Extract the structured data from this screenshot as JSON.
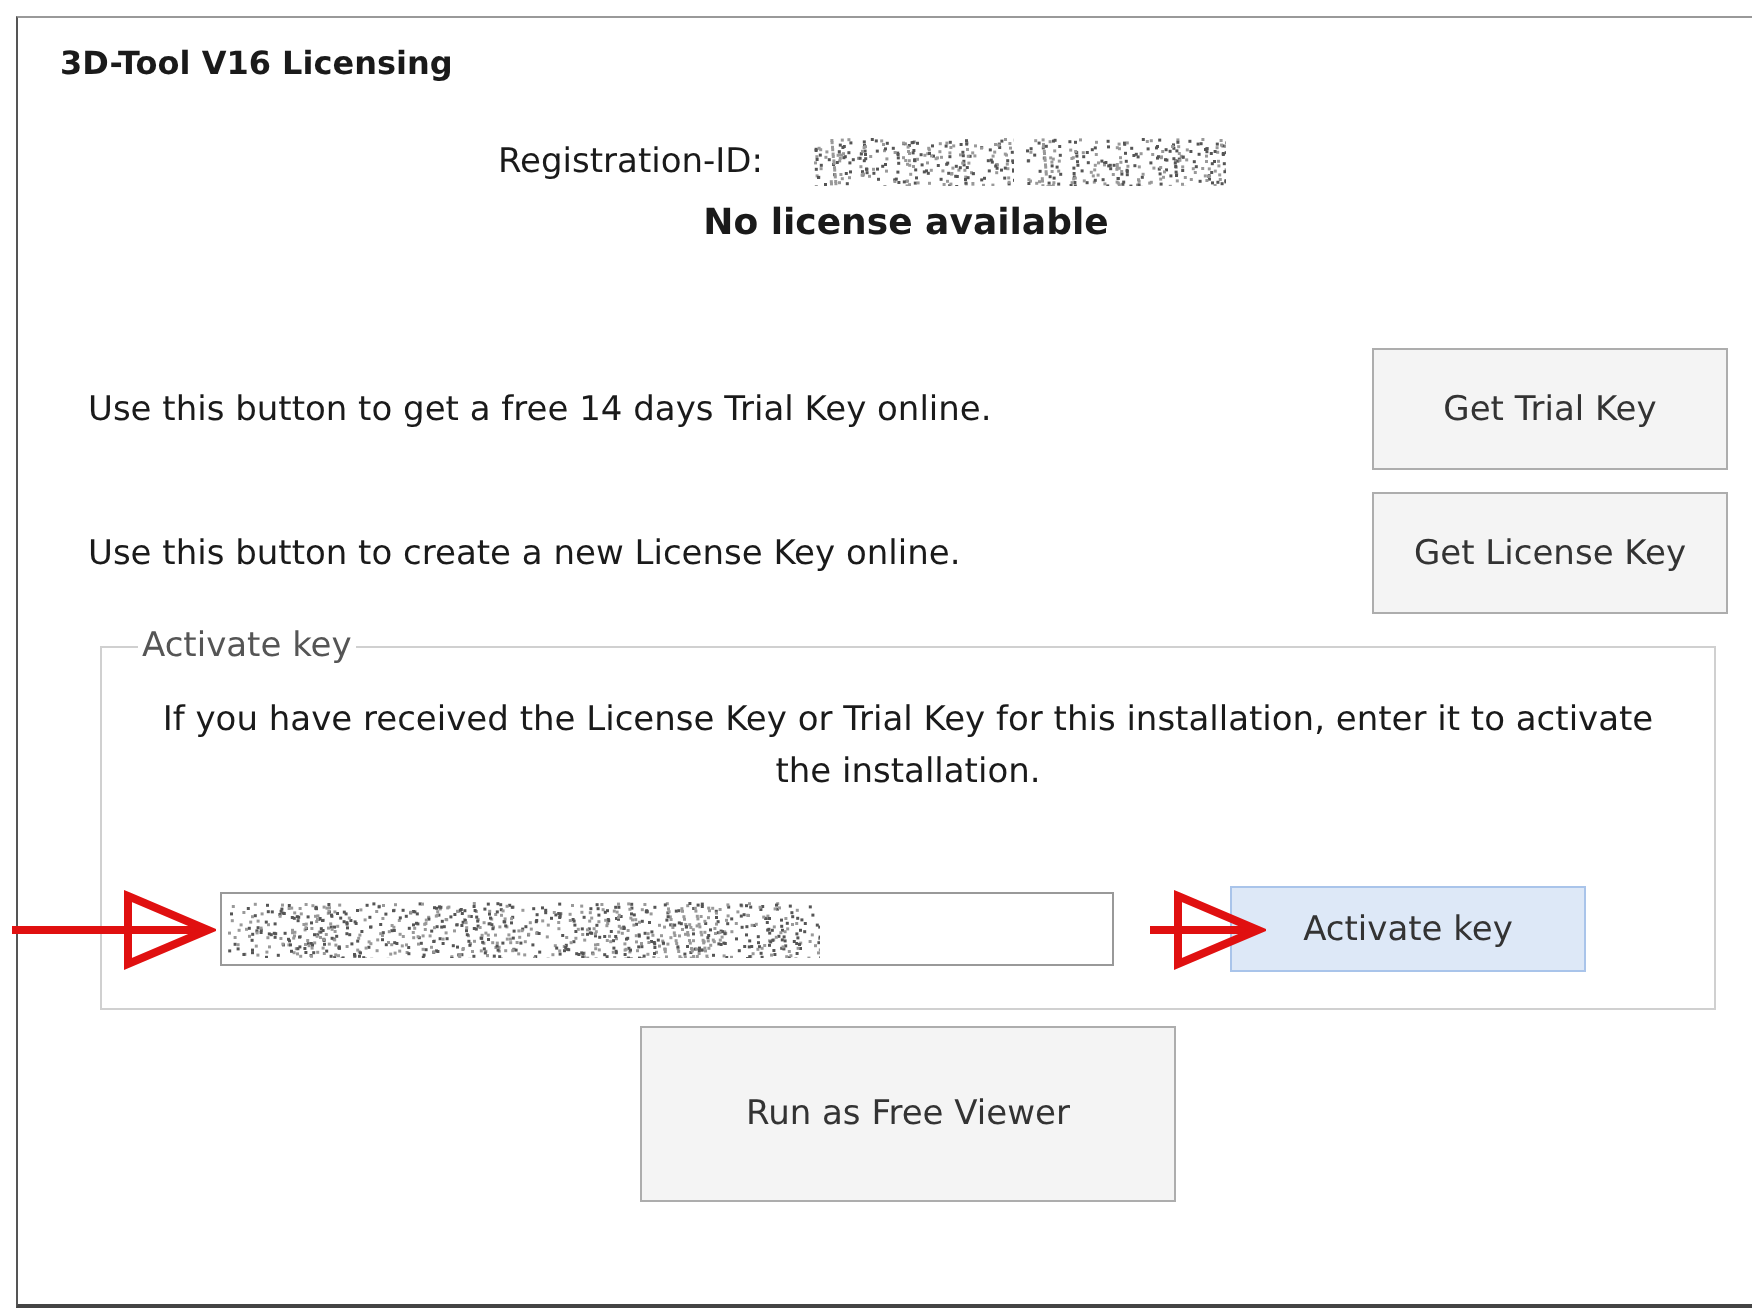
{
  "window": {
    "title": "3D-Tool V16 Licensing"
  },
  "registration": {
    "label": "Registration-ID:",
    "status": "No license available"
  },
  "actions": [
    {
      "description": "Use this button to get a free 14 days Trial Key online.",
      "button": "Get Trial Key"
    },
    {
      "description": "Use this button to create a new License Key online.",
      "button": "Get License Key"
    }
  ],
  "activate": {
    "legend": "Activate key",
    "instructions": "If you have received the License Key or Trial Key for this installation, enter it to activate the installation.",
    "button": "Activate key",
    "focused": true
  },
  "free_viewer": {
    "button": "Run as Free Viewer"
  }
}
